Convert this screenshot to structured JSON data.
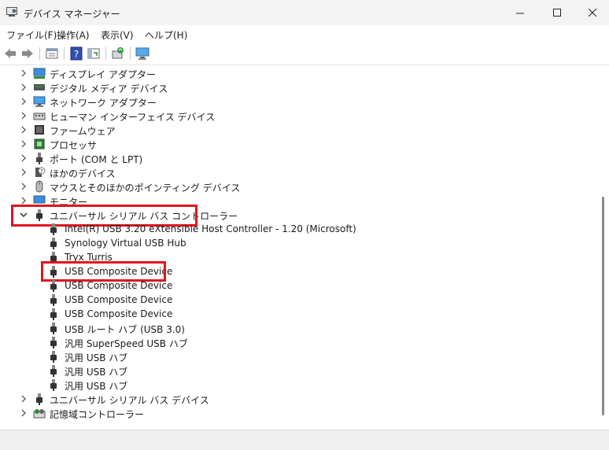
{
  "window": {
    "title": "デバイス マネージャー"
  },
  "menu": [
    {
      "label": "ファイル(F)"
    },
    {
      "label": "操作(A)"
    },
    {
      "label": "表示(V)"
    },
    {
      "label": "ヘルプ(H)"
    }
  ],
  "toolbar": [
    "back-icon",
    "forward-icon",
    "properties-icon",
    "help-icon",
    "view-icon",
    "update-driver-icon",
    "scan-hardware-icon"
  ],
  "tree": {
    "categories_top": [
      {
        "label": "ディスプレイ アダプター",
        "icon": "display-adapter-icon"
      },
      {
        "label": "デジタル メディア デバイス",
        "icon": "media-device-icon"
      },
      {
        "label": "ネットワーク アダプター",
        "icon": "network-adapter-icon"
      },
      {
        "label": "ヒューマン インターフェイス デバイス",
        "icon": "hid-icon"
      },
      {
        "label": "ファームウェア",
        "icon": "firmware-icon"
      },
      {
        "label": "プロセッサ",
        "icon": "processor-icon"
      },
      {
        "label": "ポート (COM と LPT)",
        "icon": "port-icon"
      },
      {
        "label": "ほかのデバイス",
        "icon": "unknown-device-icon"
      },
      {
        "label": "マウスとそのほかのポインティング デバイス",
        "icon": "mouse-icon"
      },
      {
        "label": "モニター",
        "icon": "monitor-icon"
      }
    ],
    "usb_controllers": {
      "label": "ユニバーサル シリアル バス コントローラー",
      "children": [
        "Intel(R) USB 3.20 eXtensible Host Controller - 1.20 (Microsoft)",
        "Synology Virtual USB Hub",
        "Tryx Turris",
        "USB Composite Device",
        "USB Composite Device",
        "USB Composite Device",
        "USB Composite Device",
        "USB ルート ハブ (USB 3.0)",
        "汎用 SuperSpeed USB ハブ",
        "汎用 USB ハブ",
        "汎用 USB ハブ",
        "汎用 USB ハブ"
      ]
    },
    "categories_bottom": [
      {
        "label": "ユニバーサル シリアル バス デバイス",
        "icon": "usb-icon"
      },
      {
        "label": "記憶域コントローラー",
        "icon": "storage-controller-icon"
      }
    ]
  },
  "colors": {
    "highlight": "#e0141e",
    "titlebar": "#f3f3f3"
  }
}
